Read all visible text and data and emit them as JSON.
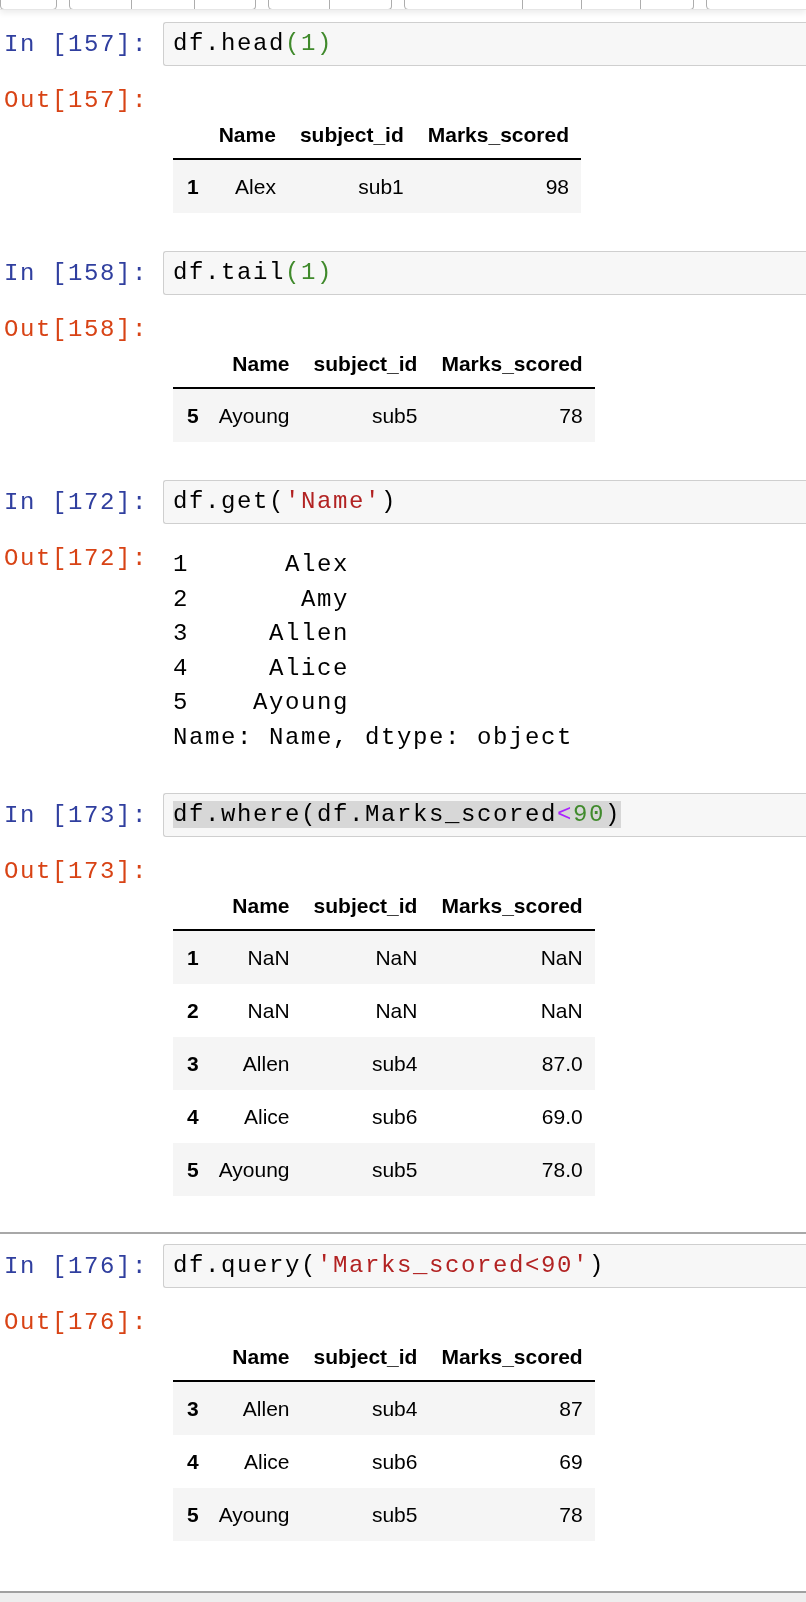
{
  "cells": [
    {
      "kind": "code",
      "prompt_in": "In [157]:",
      "highlighted": false,
      "code": [
        {
          "kind": "plain",
          "text": "df.head"
        },
        {
          "kind": "number",
          "text": "(1)"
        }
      ],
      "prompt_out": "Out[157]:",
      "output": {
        "kind": "table",
        "columns": [
          "Name",
          "subject_id",
          "Marks_scored"
        ],
        "rows": [
          {
            "index": "1",
            "cells": [
              "Alex",
              "sub1",
              "98"
            ]
          }
        ]
      }
    },
    {
      "kind": "code",
      "prompt_in": "In [158]:",
      "highlighted": false,
      "code": [
        {
          "kind": "plain",
          "text": "df.tail"
        },
        {
          "kind": "number",
          "text": "(1)"
        }
      ],
      "prompt_out": "Out[158]:",
      "output": {
        "kind": "table",
        "columns": [
          "Name",
          "subject_id",
          "Marks_scored"
        ],
        "rows": [
          {
            "index": "5",
            "cells": [
              "Ayoung",
              "sub5",
              "78"
            ]
          }
        ]
      }
    },
    {
      "kind": "code",
      "prompt_in": "In [172]:",
      "highlighted": false,
      "code": [
        {
          "kind": "plain",
          "text": "df.get("
        },
        {
          "kind": "string",
          "text": "'Name'"
        },
        {
          "kind": "plain",
          "text": ")"
        }
      ],
      "prompt_out": "Out[172]:",
      "output": {
        "kind": "text",
        "lines": [
          "1      Alex",
          "2       Amy",
          "3     Allen",
          "4     Alice",
          "5    Ayoung",
          "Name: Name, dtype: object"
        ]
      }
    },
    {
      "kind": "code",
      "prompt_in": "In [173]:",
      "highlighted": true,
      "code": [
        {
          "kind": "plain",
          "text": "df.where(df.Marks_scored"
        },
        {
          "kind": "operator",
          "text": "<"
        },
        {
          "kind": "number",
          "text": "90"
        },
        {
          "kind": "plain",
          "text": ")"
        }
      ],
      "prompt_out": "Out[173]:",
      "output": {
        "kind": "table",
        "columns": [
          "Name",
          "subject_id",
          "Marks_scored"
        ],
        "rows": [
          {
            "index": "1",
            "cells": [
              "NaN",
              "NaN",
              "NaN"
            ]
          },
          {
            "index": "2",
            "cells": [
              "NaN",
              "NaN",
              "NaN"
            ]
          },
          {
            "index": "3",
            "cells": [
              "Allen",
              "sub4",
              "87.0"
            ]
          },
          {
            "index": "4",
            "cells": [
              "Alice",
              "sub6",
              "69.0"
            ]
          },
          {
            "index": "5",
            "cells": [
              "Ayoung",
              "sub5",
              "78.0"
            ]
          }
        ]
      }
    },
    {
      "kind": "divider"
    },
    {
      "kind": "code",
      "prompt_in": "In [176]:",
      "highlighted": false,
      "code": [
        {
          "kind": "plain",
          "text": "df.query("
        },
        {
          "kind": "string",
          "text": "'Marks_scored<90'"
        },
        {
          "kind": "plain",
          "text": ")"
        }
      ],
      "prompt_out": "Out[176]:",
      "output": {
        "kind": "table",
        "columns": [
          "Name",
          "subject_id",
          "Marks_scored"
        ],
        "rows": [
          {
            "index": "3",
            "cells": [
              "Allen",
              "sub4",
              "87"
            ]
          },
          {
            "index": "4",
            "cells": [
              "Alice",
              "sub6",
              "69"
            ]
          },
          {
            "index": "5",
            "cells": [
              "Ayoung",
              "sub5",
              "78"
            ]
          }
        ]
      }
    }
  ]
}
